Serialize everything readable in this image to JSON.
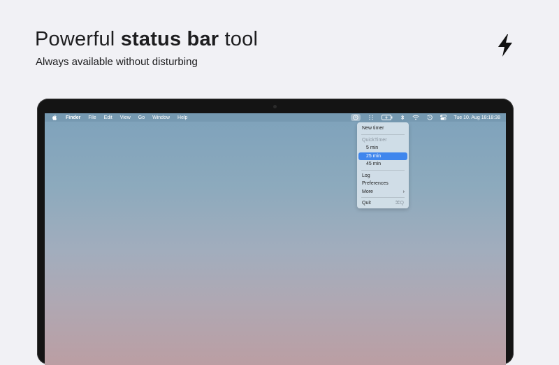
{
  "headline": {
    "prefix": "Powerful ",
    "bold": "status bar",
    "suffix": " tool",
    "subtitle": "Always available without disturbing"
  },
  "icons": {
    "headline_icon": "lightning-bolt-icon"
  },
  "menubar": {
    "app_name": "Finder",
    "items": [
      "File",
      "Edit",
      "View",
      "Go",
      "Window",
      "Help"
    ],
    "clock": "Tue 10. Aug  18:18:38"
  },
  "menu": {
    "new_timer": "New timer",
    "section_header": "QuickTimer",
    "presets": [
      "5 min",
      "25 min",
      "45 min"
    ],
    "selected_preset": "25 min",
    "log": "Log",
    "preferences": "Preferences",
    "more": "More",
    "more_chevron": "›",
    "quit": "Quit",
    "quit_shortcut": "⌘Q"
  },
  "colors": {
    "page_bg": "#f1f1f5",
    "accent": "#3f86ed",
    "text": "#1d1d1f"
  }
}
